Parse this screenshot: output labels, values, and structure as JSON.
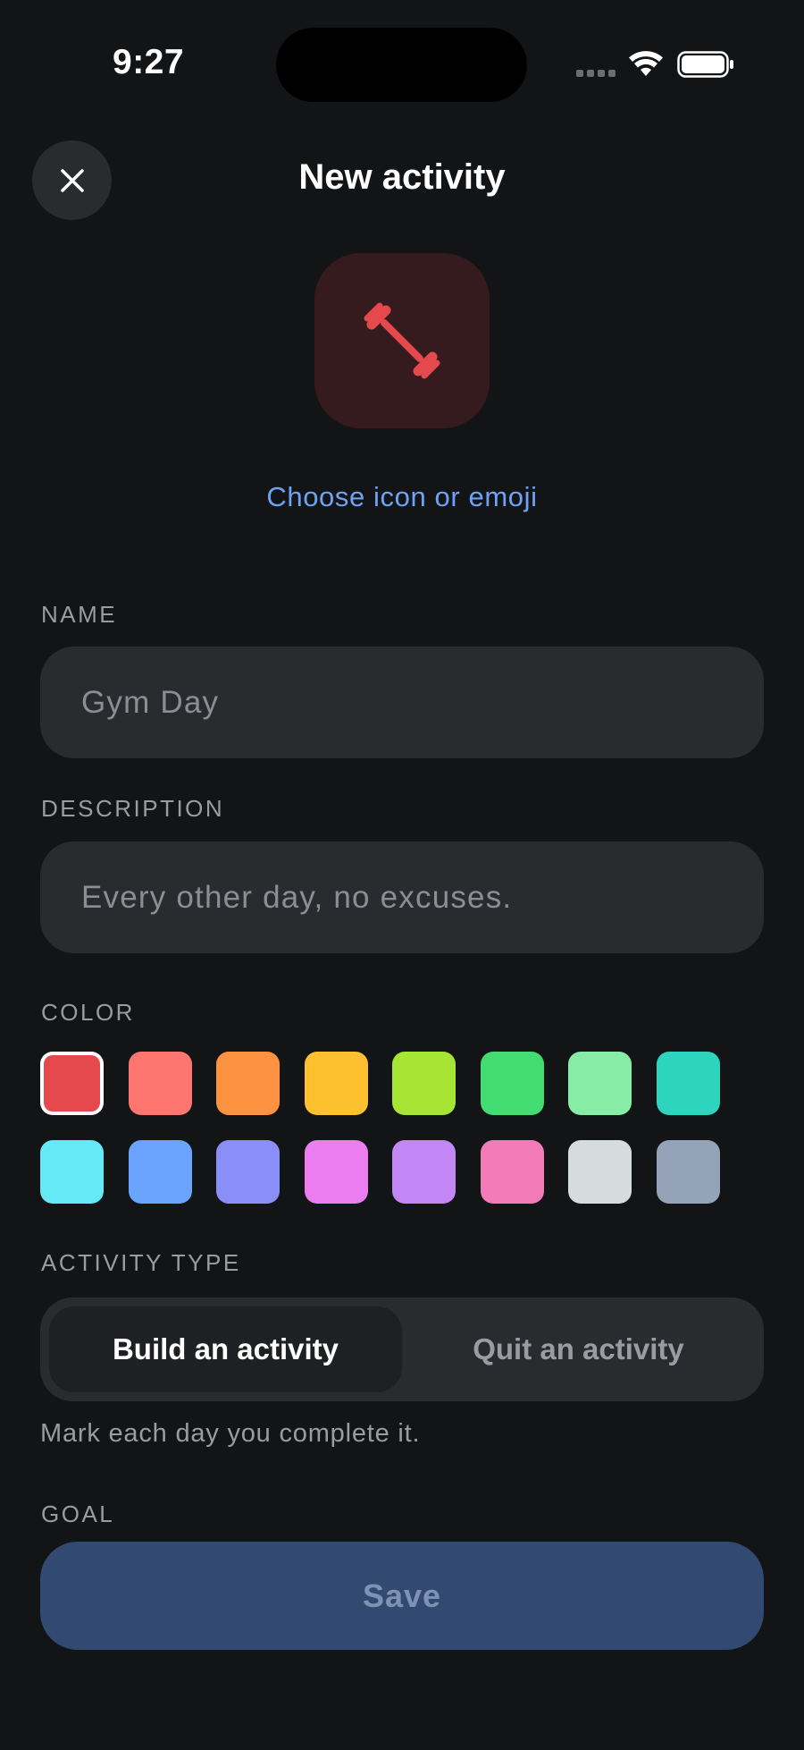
{
  "status_bar": {
    "time": "9:27"
  },
  "header": {
    "title": "New activity"
  },
  "icon_preview": {
    "icon": "dumbbell-icon",
    "color": "#e5484d",
    "link_label": "Choose icon or emoji"
  },
  "name_section": {
    "label": "NAME",
    "placeholder": "Gym Day"
  },
  "description_section": {
    "label": "DESCRIPTION",
    "placeholder": "Every other day, no excuses."
  },
  "color_section": {
    "label": "COLOR",
    "selected_index": 0,
    "colors": [
      "#e5484d",
      "#ff7570",
      "#fd9340",
      "#fdc02e",
      "#a6e534",
      "#43dc72",
      "#87eda6",
      "#2ed5be",
      "#66e9f7",
      "#6aa4ff",
      "#8a8ff7",
      "#ec7df1",
      "#c386f5",
      "#f37bb8",
      "#d6dbdb",
      "#94a3b8"
    ]
  },
  "activity_type": {
    "label": "ACTIVITY TYPE",
    "options": [
      "Build an activity",
      "Quit an activity"
    ],
    "selected": "Build an activity",
    "hint": "Mark each day you complete it."
  },
  "goal_section": {
    "label": "GOAL"
  },
  "save_button": {
    "label": "Save"
  }
}
